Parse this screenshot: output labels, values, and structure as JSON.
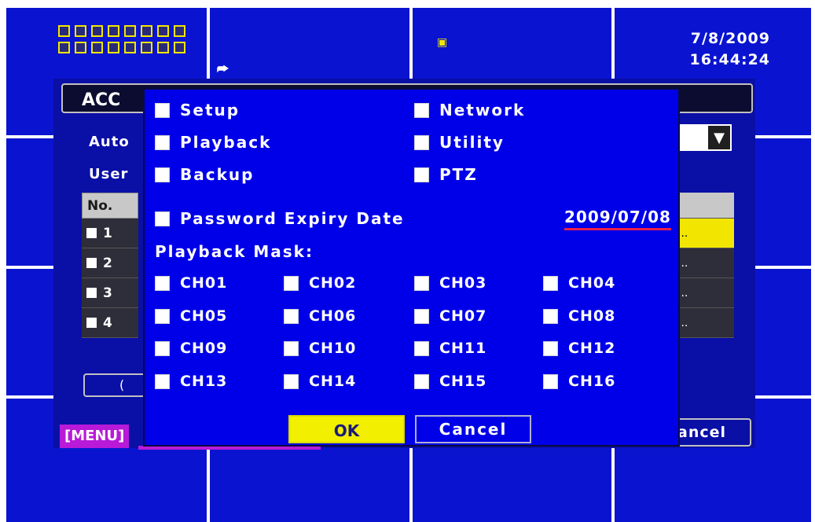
{
  "status_bar": {
    "date": "7/8/2009",
    "time": "16:44:24",
    "channel_indicator_count": 16,
    "icons": [
      "channel-grid-icon",
      "audio-icon",
      "network-icon"
    ]
  },
  "background_panel": {
    "title": "ACC",
    "label_auto": "Auto",
    "label_user": "User",
    "table": {
      "header": "No.",
      "rows": [
        "1",
        "2",
        "3",
        "4"
      ],
      "right_column": [
        "",
        "...",
        "...",
        "...",
        "..."
      ]
    },
    "small_button": "(",
    "cancel_label": "ancel",
    "menu_label": "[MENU]"
  },
  "dialog": {
    "permissions": [
      {
        "label": "Setup"
      },
      {
        "label": "Network"
      },
      {
        "label": "Playback"
      },
      {
        "label": "Utility"
      },
      {
        "label": "Backup"
      },
      {
        "label": "PTZ"
      }
    ],
    "password_expiry": {
      "label": "Password Expiry Date",
      "value": "2009/07/08"
    },
    "playback_mask_label": "Playback Mask:",
    "channels": [
      "CH01",
      "CH02",
      "CH03",
      "CH04",
      "CH05",
      "CH06",
      "CH07",
      "CH08",
      "CH09",
      "CH10",
      "CH11",
      "CH12",
      "CH13",
      "CH14",
      "CH15",
      "CH16"
    ],
    "ok_label": "OK",
    "cancel_label": "Cancel"
  },
  "colors": {
    "screen_blue": "#0a14d0",
    "dialog_blue": "#0000e8",
    "highlight_yellow": "#f2ef00",
    "menu_magenta": "#b81ad8",
    "date_underline": "#e8204a"
  }
}
